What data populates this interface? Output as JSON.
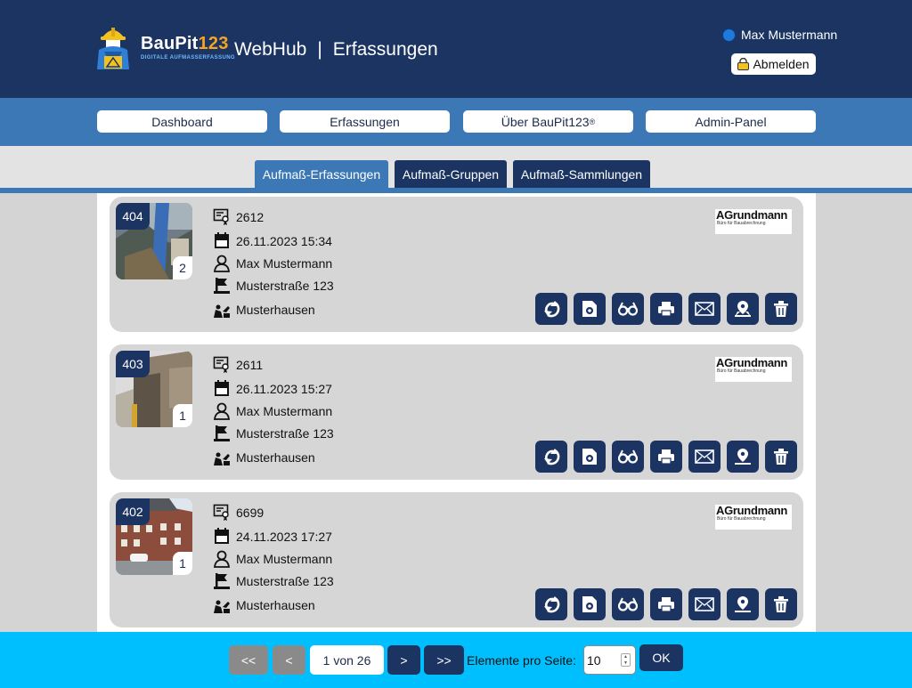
{
  "header": {
    "brand_name_main": "BauPit",
    "brand_name_num": "123",
    "brand_tagline": "DIGITALE AUFMASSERFASSUNG",
    "app": "WebHub",
    "separator": "|",
    "section": "Erfassungen",
    "user_name": "Max Mustermann",
    "logout_label": "Abmelden"
  },
  "nav": {
    "items": [
      {
        "label": "Dashboard"
      },
      {
        "label": "Erfassungen"
      },
      {
        "label": "Über BauPit123",
        "sup": "®"
      },
      {
        "label": "Admin-Panel"
      }
    ]
  },
  "tabs": [
    {
      "label": "Aufmaß-Erfassungen",
      "active": true
    },
    {
      "label": "Aufmaß-Gruppen",
      "active": false
    },
    {
      "label": "Aufmaß-Sammlungen",
      "active": false
    }
  ],
  "cards": [
    {
      "id": "404",
      "photo_count": "2",
      "number": "2612",
      "datetime": "26.11.2023 15:34",
      "user": "Max Mustermann",
      "street": "Musterstraße 123",
      "city": "Musterhausen",
      "company_name": "AGrundmann",
      "company_sub": "Büro für Bauabrechnung"
    },
    {
      "id": "403",
      "photo_count": "1",
      "number": "2611",
      "datetime": "26.11.2023 15:27",
      "user": "Max Mustermann",
      "street": "Musterstraße 123",
      "city": "Musterhausen",
      "company_name": "AGrundmann",
      "company_sub": "Büro für Bauabrechnung"
    },
    {
      "id": "402",
      "photo_count": "1",
      "number": "6699",
      "datetime": "24.11.2023 17:27",
      "user": "Max Mustermann",
      "street": "Musterstraße 123",
      "city": "Musterhausen",
      "company_name": "AGrundmann",
      "company_sub": "Büro für Bauabrechnung"
    }
  ],
  "card_actions": [
    "sync-icon",
    "document-view-icon",
    "glasses-icon",
    "print-icon",
    "mail-icon",
    "map-pin-icon",
    "trash-icon"
  ],
  "pagination": {
    "first": "<<",
    "prev": "<",
    "info": "1 von 26",
    "next": ">",
    "last": ">>",
    "per_page_label": "Elemente pro Seite:",
    "per_page_value": "10",
    "ok": "OK"
  },
  "colors": {
    "primary": "#1c3462",
    "accent": "#3c78b6",
    "footer": "#00bfff"
  }
}
